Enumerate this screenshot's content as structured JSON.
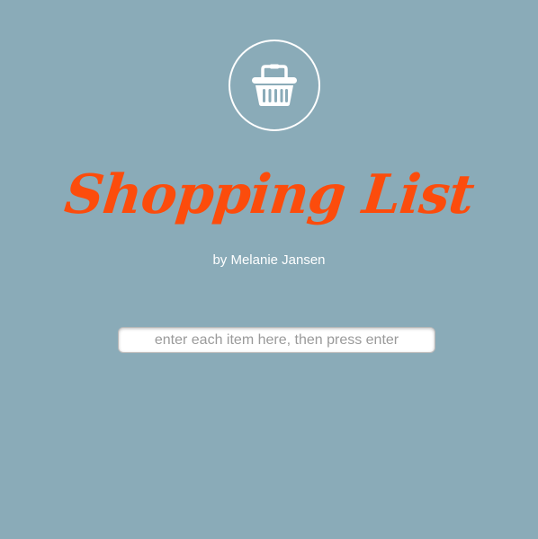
{
  "header": {
    "icon": "shopping-basket-icon",
    "title": "Shopping List",
    "byline": "by Melanie Jansen"
  },
  "entry": {
    "value": "",
    "placeholder": "enter each item here, then press enter"
  },
  "colors": {
    "background": "#8aabb8",
    "title": "#fc4c0c",
    "icon": "#ffffff"
  }
}
